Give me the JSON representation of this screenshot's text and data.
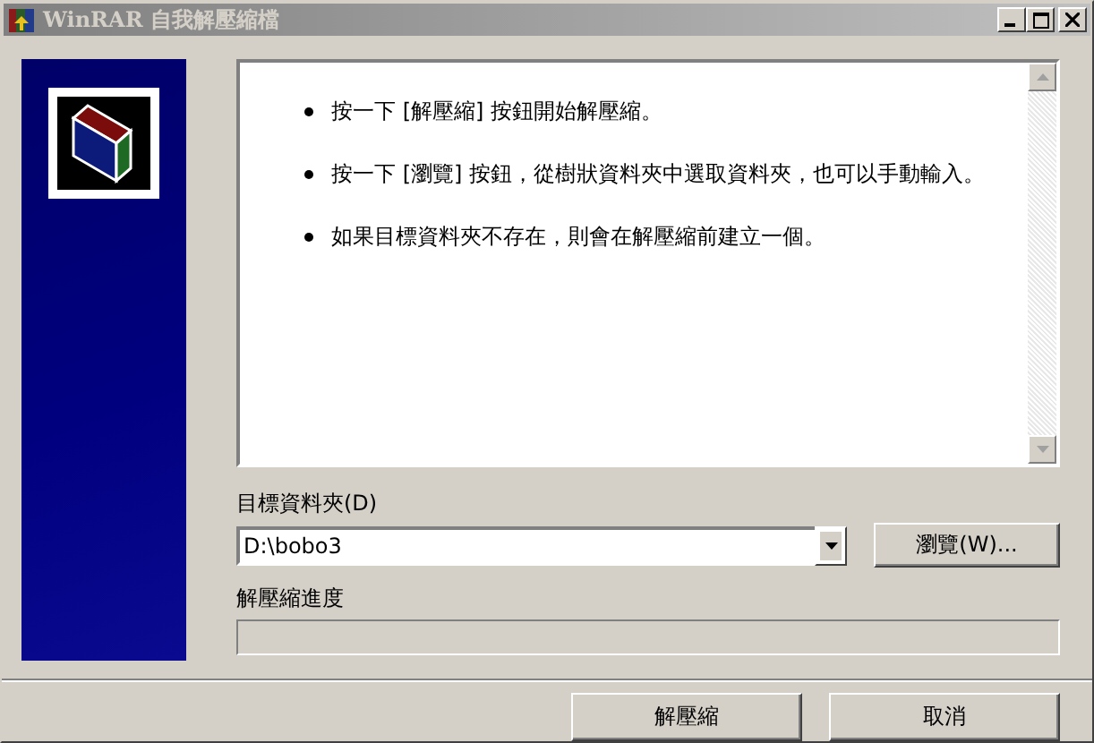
{
  "window": {
    "title": "WinRAR 自我解壓縮檔"
  },
  "instructions": [
    "按一下 [解壓縮] 按鈕開始解壓縮。",
    "按一下 [瀏覽] 按鈕，從樹狀資料夾中選取資料夾，也可以手動輸入。",
    "如果目標資料夾不存在，則會在解壓縮前建立一個。"
  ],
  "destination": {
    "label": "目標資料夾(D)",
    "value": "D:\\bobo3",
    "browse_button": "瀏覽(W)..."
  },
  "progress": {
    "label": "解壓縮進度",
    "level": 0
  },
  "buttons": [
    "解壓縮",
    "取消"
  ]
}
